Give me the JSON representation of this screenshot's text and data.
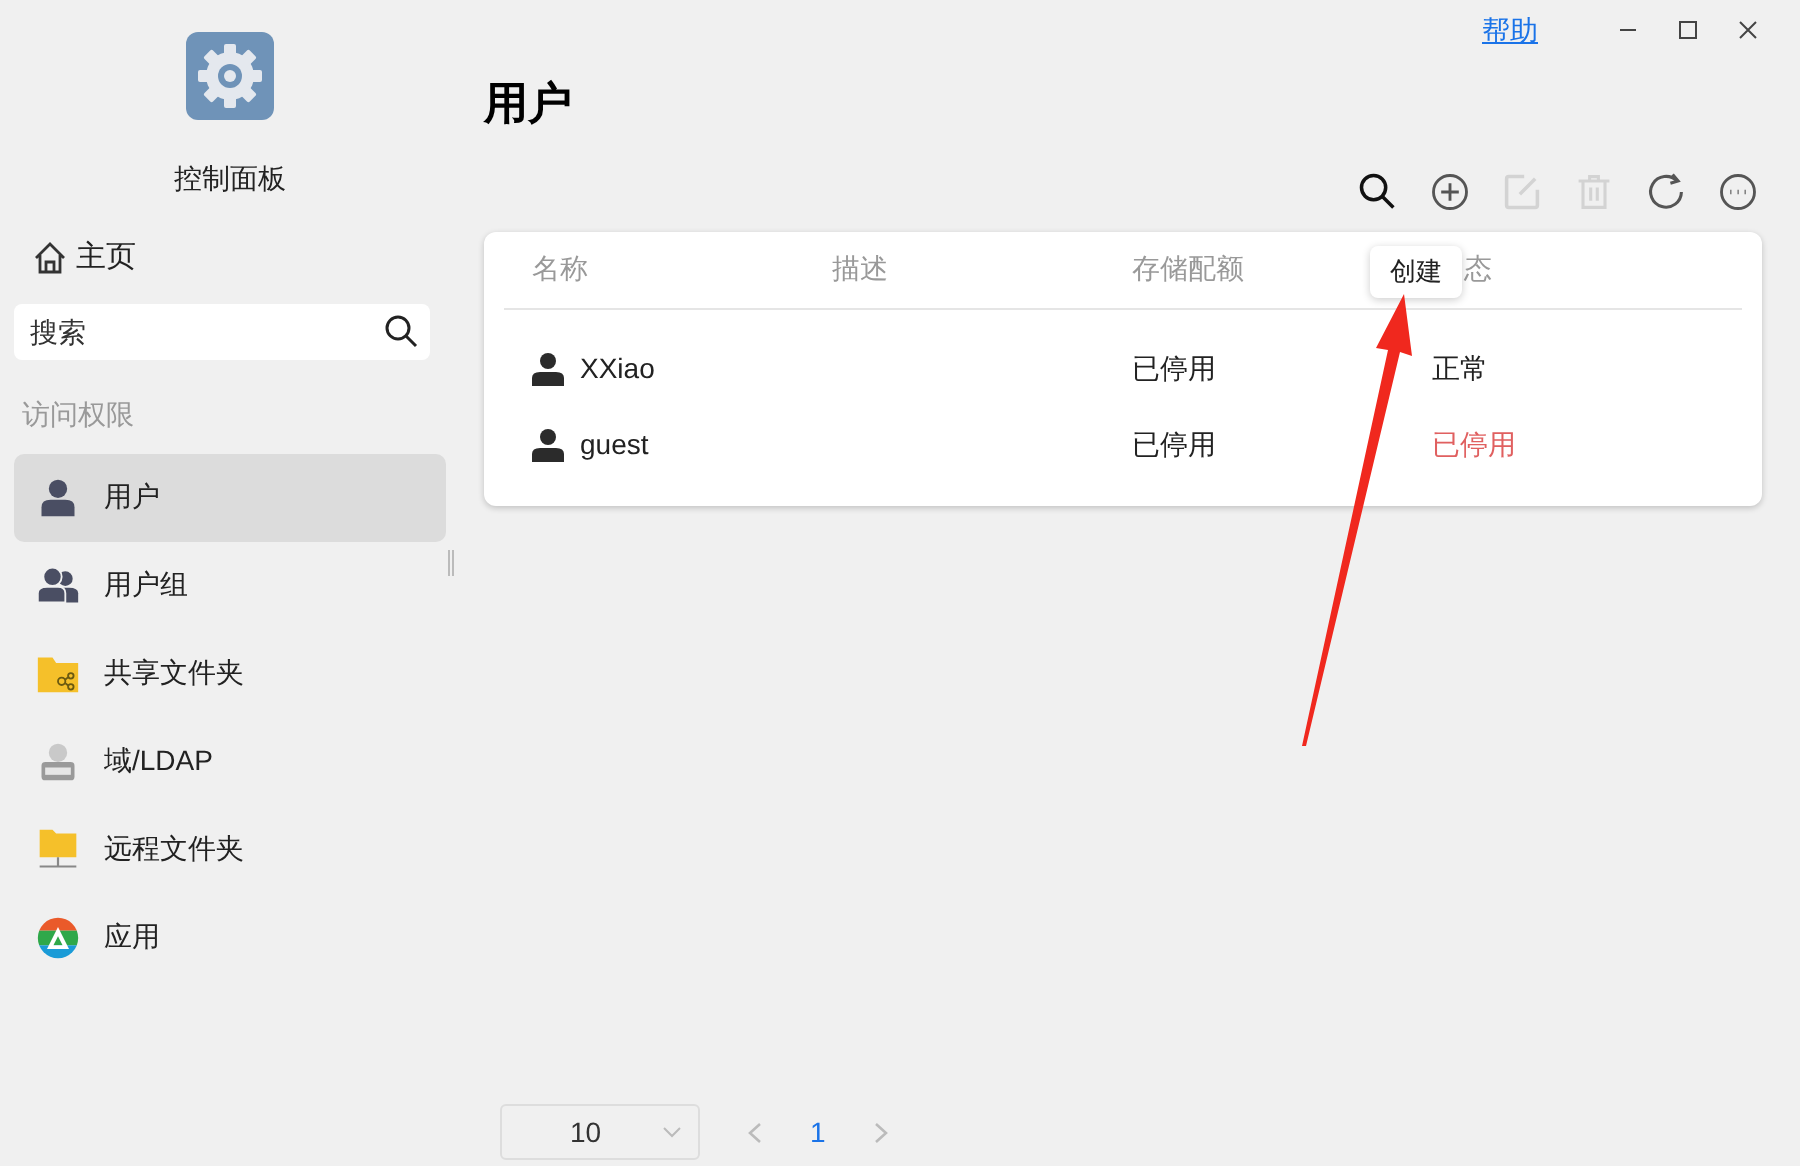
{
  "window": {
    "help_link": "帮助"
  },
  "sidebar": {
    "app_title": "控制面板",
    "home": "主页",
    "search": {
      "placeholder": "搜索"
    },
    "section": "访问权限",
    "items": [
      {
        "label": "用户",
        "kind": "user",
        "selected": true
      },
      {
        "label": "用户组",
        "kind": "group",
        "selected": false
      },
      {
        "label": "共享文件夹",
        "kind": "shared-folder",
        "selected": false
      },
      {
        "label": "域/LDAP",
        "kind": "ldap",
        "selected": false
      },
      {
        "label": "远程文件夹",
        "kind": "remote-folder",
        "selected": false
      },
      {
        "label": "应用",
        "kind": "app",
        "selected": false
      }
    ]
  },
  "page_title": "用户",
  "toolbar": [
    {
      "kind": "search",
      "disabled": false
    },
    {
      "kind": "add",
      "disabled": false
    },
    {
      "kind": "edit",
      "disabled": true
    },
    {
      "kind": "delete",
      "disabled": true
    },
    {
      "kind": "refresh",
      "disabled": false
    },
    {
      "kind": "more",
      "disabled": false
    }
  ],
  "tooltip": "创建",
  "table": {
    "columns": [
      "名称",
      "描述",
      "存储配额",
      "态"
    ],
    "rows": [
      {
        "name": "XXiao",
        "quota": "已停用",
        "status": "正常",
        "status_disabled": false
      },
      {
        "name": "guest",
        "quota": "已停用",
        "status": "已停用",
        "status_disabled": true
      }
    ]
  },
  "pagination": {
    "page_size": "10",
    "page": "1"
  }
}
